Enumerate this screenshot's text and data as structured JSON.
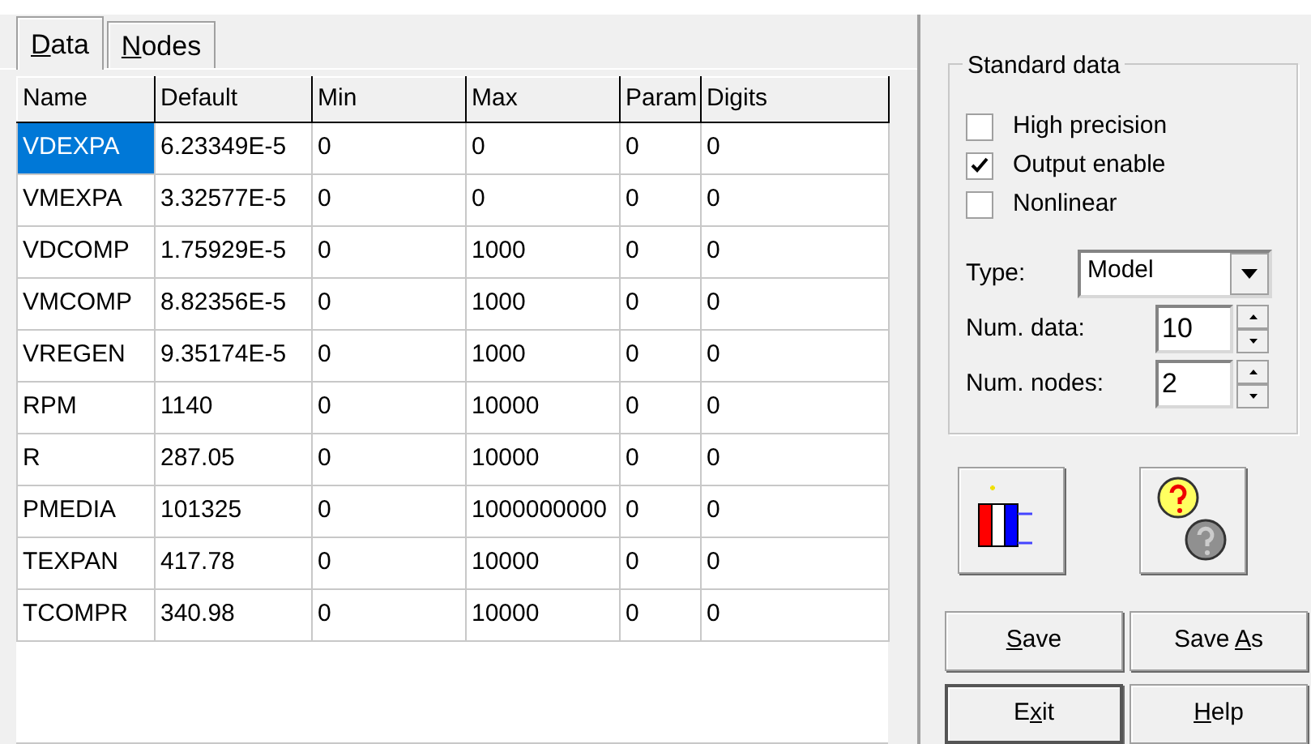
{
  "tabs": [
    {
      "label_parts": [
        {
          "text": "D",
          "underlined": true
        },
        {
          "text": "ata",
          "underlined": false
        }
      ],
      "selected": true
    },
    {
      "label_parts": [
        {
          "text": "N",
          "underlined": true
        },
        {
          "text": "odes",
          "underlined": false
        }
      ],
      "selected": false
    }
  ],
  "table": {
    "columns": [
      "Name",
      "Default",
      "Min",
      "Max",
      "Param",
      "Digits"
    ],
    "rows": [
      {
        "cells": [
          "VDEXPA",
          "6.23349E-5",
          "0",
          "0",
          "0",
          "0"
        ],
        "selected": true
      },
      {
        "cells": [
          "VMEXPA",
          "3.32577E-5",
          "0",
          "0",
          "0",
          "0"
        ],
        "selected": false
      },
      {
        "cells": [
          "VDCOMP",
          "1.75929E-5",
          "0",
          "1000",
          "0",
          "0"
        ],
        "selected": false
      },
      {
        "cells": [
          "VMCOMP",
          "8.82356E-5",
          "0",
          "1000",
          "0",
          "0"
        ],
        "selected": false
      },
      {
        "cells": [
          "VREGEN",
          "9.35174E-5",
          "0",
          "1000",
          "0",
          "0"
        ],
        "selected": false
      },
      {
        "cells": [
          "RPM",
          "1140",
          "0",
          "10000",
          "0",
          "0"
        ],
        "selected": false
      },
      {
        "cells": [
          "R",
          "287.05",
          "0",
          "10000",
          "0",
          "0"
        ],
        "selected": false
      },
      {
        "cells": [
          "PMEDIA",
          "101325",
          "0",
          "1000000000",
          "0",
          "0"
        ],
        "selected": false
      },
      {
        "cells": [
          "TEXPAN",
          "417.78",
          "0",
          "10000",
          "0",
          "0"
        ],
        "selected": false
      },
      {
        "cells": [
          "TCOMPR",
          "340.98",
          "0",
          "10000",
          "0",
          "0"
        ],
        "selected": false
      }
    ]
  },
  "standard_data": {
    "title": "Standard data",
    "checkboxes": [
      {
        "label": "High precision",
        "checked": false
      },
      {
        "label": "Output enable",
        "checked": true
      },
      {
        "label": "Nonlinear",
        "checked": false
      }
    ],
    "type": {
      "label": "Type:",
      "value": "Model"
    },
    "spinners": [
      {
        "label": "Num. data:",
        "value": "10"
      },
      {
        "label": "Num. nodes:",
        "value": "2"
      }
    ]
  },
  "buttons": [
    {
      "label_parts": [
        {
          "text": "S",
          "underlined": true
        },
        {
          "text": "ave",
          "underlined": false
        }
      ]
    },
    {
      "label_parts": [
        {
          "text": "Save ",
          "underlined": false
        },
        {
          "text": "A",
          "underlined": true
        },
        {
          "text": "s",
          "underlined": false
        }
      ]
    },
    {
      "label_parts": [
        {
          "text": "E",
          "underlined": false
        },
        {
          "text": "x",
          "underlined": true
        },
        {
          "text": "it",
          "underlined": false
        }
      ]
    },
    {
      "label_parts": [
        {
          "text": "H",
          "underlined": true
        },
        {
          "text": "elp",
          "underlined": false
        }
      ]
    }
  ]
}
